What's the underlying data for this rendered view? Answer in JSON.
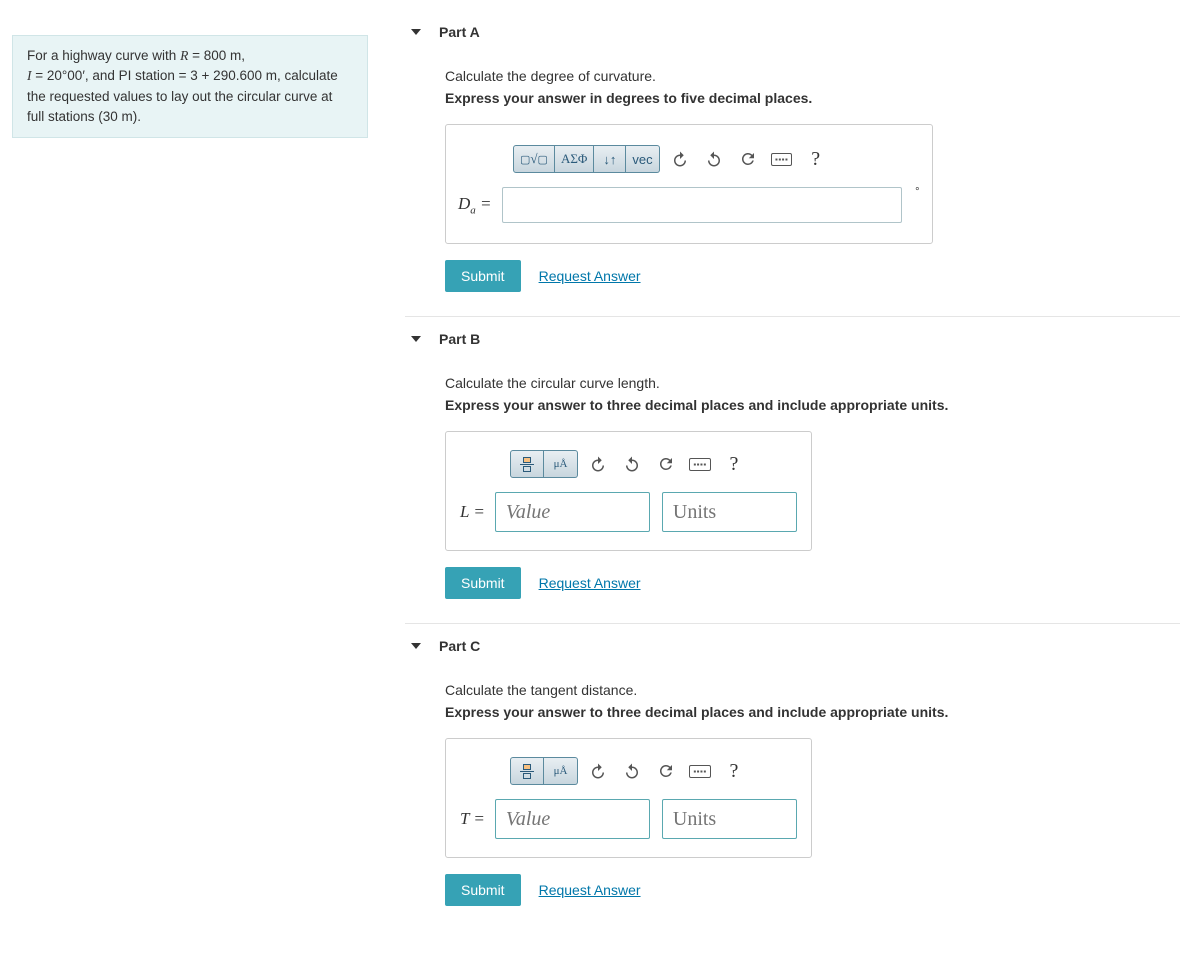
{
  "question": {
    "html": "For a highway curve with <span class='math'>R</span> = 800 m, <span class='math'>I</span> = 20°00′, and PI station = 3 + 290.600 m, calculate the requested values to lay out the circular curve at full stations (30 m)."
  },
  "parts": {
    "a": {
      "title": "Part A",
      "instruction": "Calculate the degree of curvature.",
      "bold": "Express your answer in degrees to five decimal places.",
      "var_html": "D<sub class='sub'>a</sub> =",
      "unit_suffix": "°",
      "toolbar": {
        "templates": "▢√▢",
        "greek": "ΑΣΦ",
        "updown": "↓↑",
        "vec": "vec"
      },
      "submit": "Submit",
      "request": "Request Answer"
    },
    "b": {
      "title": "Part B",
      "instruction": "Calculate the circular curve length.",
      "bold": "Express your answer to three decimal places and include appropriate units.",
      "var": "L =",
      "value_ph": "Value",
      "units_ph": "Units",
      "submit": "Submit",
      "request": "Request Answer"
    },
    "c": {
      "title": "Part C",
      "instruction": "Calculate the tangent distance.",
      "bold": "Express your answer to three decimal places and include appropriate units.",
      "var": "T =",
      "value_ph": "Value",
      "units_ph": "Units",
      "submit": "Submit",
      "request": "Request Answer"
    }
  },
  "common": {
    "help": "?",
    "kbd": "⌨",
    "ua_label": "μÅ"
  }
}
